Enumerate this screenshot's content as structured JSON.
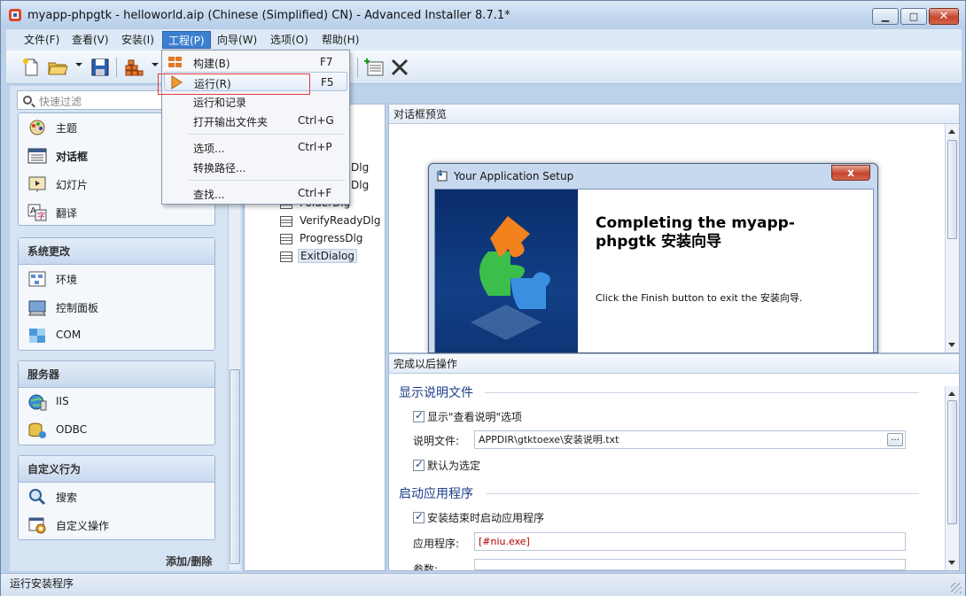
{
  "window": {
    "title": "myapp-phpgtk - helloworld.aip (Chinese (Simplified) CN) - Advanced Installer 8.7.1*",
    "minimize_glyph": "▁",
    "maximize_glyph": "□",
    "close_glyph": "✕"
  },
  "menubar": [
    {
      "label": "文件(F)"
    },
    {
      "label": "查看(V)"
    },
    {
      "label": "安装(I)"
    },
    {
      "label": "工程(P)",
      "active": true
    },
    {
      "label": "向导(W)"
    },
    {
      "label": "选项(O)"
    },
    {
      "label": "帮助(H)"
    }
  ],
  "project_menu": {
    "items": [
      {
        "label": "构建(B)",
        "shortcut": "F7",
        "icon": "build-icon"
      },
      {
        "label": "运行(R)",
        "shortcut": "F5",
        "icon": "run-icon",
        "highlighted": true
      },
      {
        "label": "运行和记录",
        "shortcut": "",
        "icon": ""
      },
      {
        "label": "打开输出文件夹",
        "shortcut": "Ctrl+G",
        "icon": ""
      },
      {
        "label": "选项...",
        "shortcut": "Ctrl+P",
        "icon": ""
      },
      {
        "label": "转换路径...",
        "shortcut": "",
        "icon": ""
      },
      {
        "label": "查找...",
        "shortcut": "Ctrl+F",
        "icon": ""
      }
    ]
  },
  "left_panel": {
    "search_placeholder": "快速过滤",
    "group_top_items": [
      {
        "label": "主题",
        "icon": "theme-icon"
      },
      {
        "label": "对话框",
        "icon": "dialogs-icon",
        "selected": true
      },
      {
        "label": "幻灯片",
        "icon": "slideshow-icon"
      },
      {
        "label": "翻译",
        "icon": "translation-icon"
      }
    ],
    "system_group": {
      "title": "系统更改",
      "items": [
        {
          "label": "环境",
          "icon": "environment-icon"
        },
        {
          "label": "控制面板",
          "icon": "control-panel-icon"
        },
        {
          "label": "COM",
          "icon": "com-icon"
        }
      ]
    },
    "server_group": {
      "title": "服务器",
      "items": [
        {
          "label": "IIS",
          "icon": "iis-icon"
        },
        {
          "label": "ODBC",
          "icon": "odbc-icon"
        }
      ]
    },
    "custom_group": {
      "title": "自定义行为",
      "items": [
        {
          "label": "搜索",
          "icon": "search-icon"
        },
        {
          "label": "自定义操作",
          "icon": "custom-action-icon"
        }
      ]
    },
    "add_remove": "添加/删除"
  },
  "tree": {
    "items": [
      {
        "label": "Dlg",
        "partial": true
      },
      {
        "label": "Dlg",
        "partial": true
      },
      {
        "label": "FolderDlg",
        "partial": true
      },
      {
        "label": "VerifyReadyDlg"
      },
      {
        "label": "ProgressDlg"
      },
      {
        "label": "ExitDialog",
        "selected": true
      }
    ]
  },
  "preview": {
    "header": "对话框预览",
    "dialog_title": "Your Application Setup",
    "dialog_close": "x",
    "heading": "Completing the myapp-phpgtk 安装向导",
    "body": "Click the Finish button to exit the 安装向导."
  },
  "after_actions": {
    "header": "完成以后操作",
    "readme_section": "显示说明文件",
    "show_readme_option": "显示\"查看说明\"选项",
    "readme_file_label": "说明文件:",
    "readme_file_value": "APPDIR\\gtktoexe\\安装说明.txt",
    "browse_label": "...",
    "default_selected": "默认为选定",
    "launch_section": "启动应用程序",
    "launch_on_finish": "安装结束时启动应用程序",
    "app_label": "应用程序:",
    "app_value": "[#niu.exe]",
    "args_label": "参数:"
  },
  "statusbar": {
    "text": "运行安装程序"
  },
  "colors": {
    "accent": "#3c7fd0",
    "highlight_box": "#e03a3a",
    "section_title": "#1d3e8a",
    "app_value": "#b00000"
  }
}
